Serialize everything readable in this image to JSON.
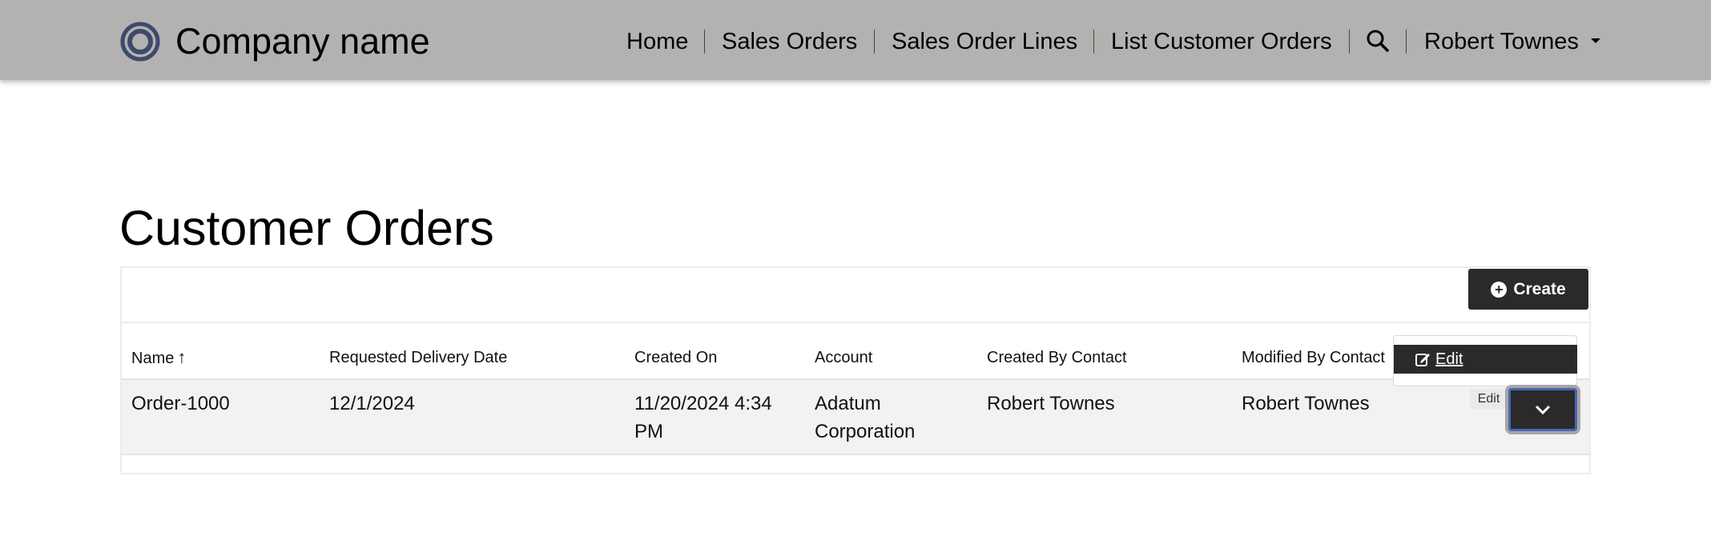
{
  "brand": {
    "name": "Company name",
    "logo_icon": "ring-logo-icon"
  },
  "nav": {
    "items": [
      {
        "label": "Home"
      },
      {
        "label": "Sales Orders"
      },
      {
        "label": "Sales Order Lines"
      },
      {
        "label": "List Customer Orders"
      }
    ],
    "search_icon": "search-icon",
    "user_name": "Robert Townes"
  },
  "page": {
    "title": "Customer Orders"
  },
  "toolbar": {
    "create_label": "Create",
    "create_icon": "plus-circle-icon"
  },
  "table": {
    "columns": [
      "Name",
      "Requested Delivery Date",
      "Created On",
      "Account",
      "Created By Contact",
      "Modified By Contact"
    ],
    "sort": {
      "column": "Name",
      "direction": "ascending"
    },
    "rows": [
      {
        "name": "Order-1000",
        "requested_delivery_date": "12/1/2024",
        "created_on_line1": "11/20/2024 4:34",
        "created_on_line2": "PM",
        "account_line1": "Adatum",
        "account_line2": "Corporation",
        "created_by": "Robert Townes",
        "modified_by": "Robert Townes"
      }
    ]
  },
  "row_menu": {
    "edit_label": "Edit",
    "tooltip": "Edit"
  },
  "colors": {
    "navbar": "#b3b2b0",
    "button_dark": "#2b2a29",
    "focus_ring": "#4a67b5",
    "logo": "#3d4a6b"
  }
}
